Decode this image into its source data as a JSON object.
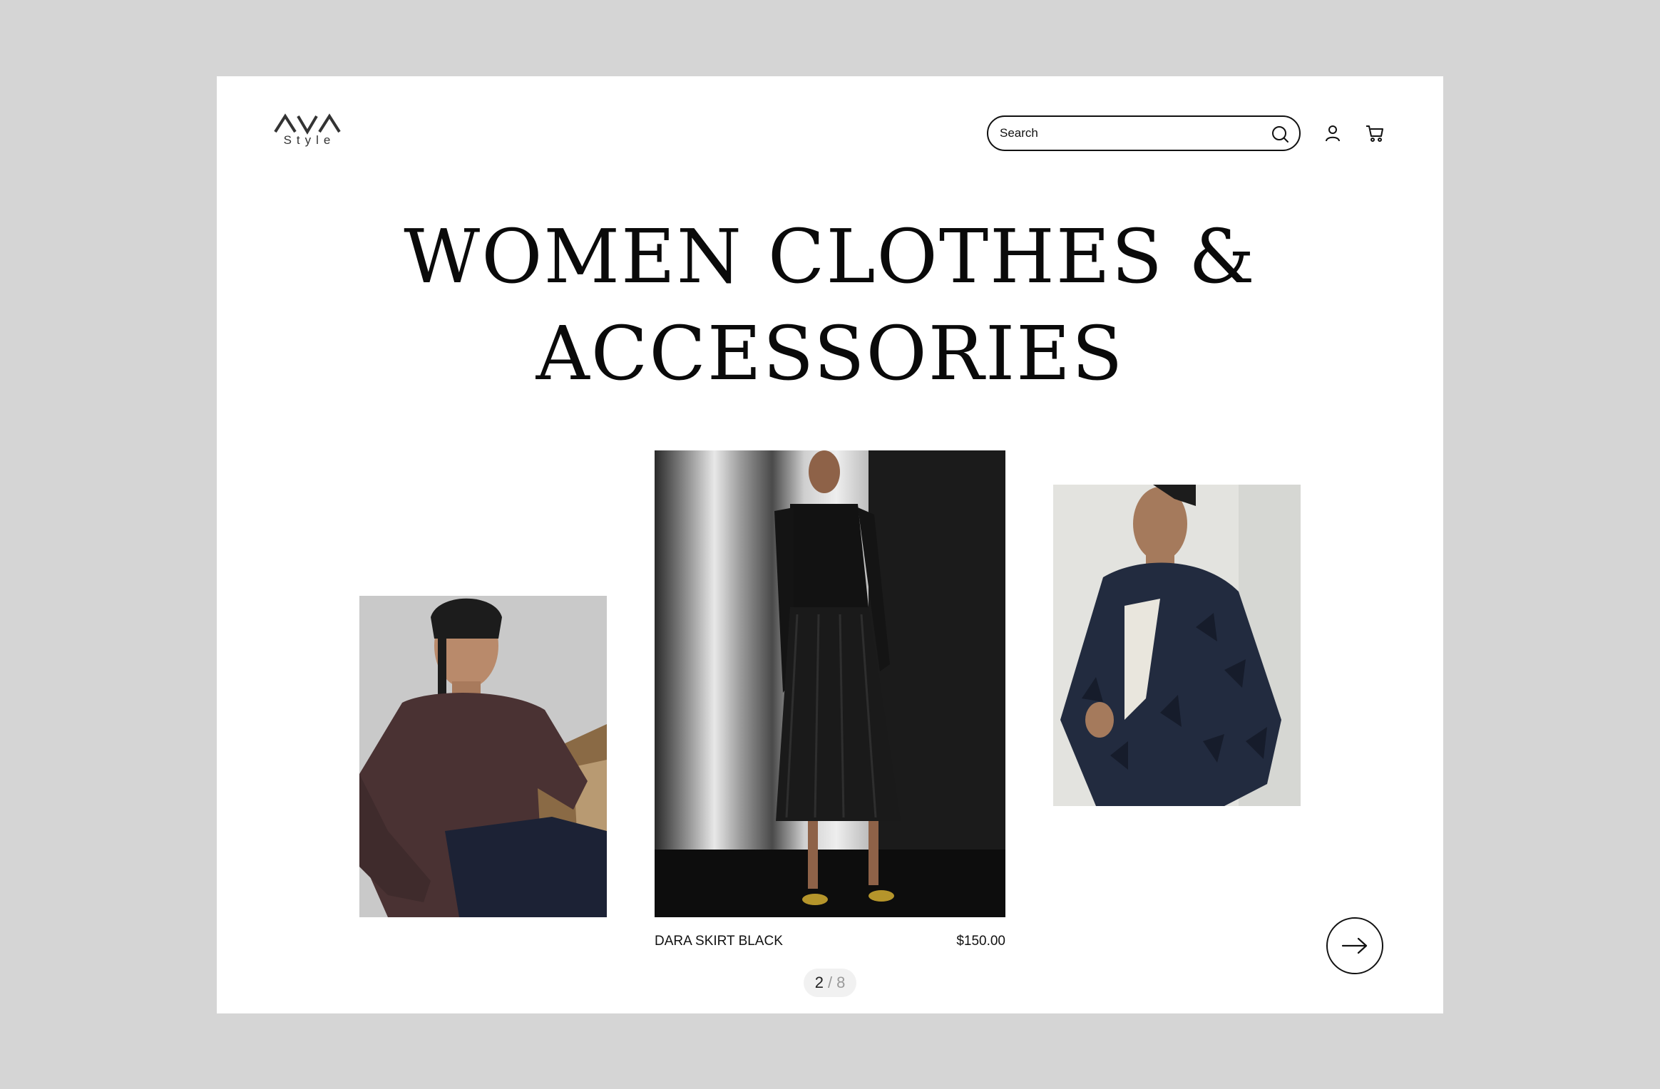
{
  "brand": {
    "logo_mark": "AVA",
    "logo_sub": "Style"
  },
  "header": {
    "search_placeholder": "Search",
    "icons": [
      "search-icon",
      "user-icon",
      "cart-icon"
    ]
  },
  "hero": {
    "title_line1": "WOMEN CLOTHES &",
    "title_line2": "ACCESSORIES"
  },
  "carousel": {
    "items": [
      {
        "image": "woman-in-knit-top-photo"
      },
      {
        "image": "woman-in-pleated-black-dress-photo"
      },
      {
        "image": "woman-in-fringe-jacket-photo"
      }
    ],
    "active_product": {
      "name": "DARA SKIRT BLACK",
      "price": "$150.00"
    },
    "pager": {
      "current": "2",
      "separator": "/",
      "total": "8"
    },
    "next_icon": "arrow-right-icon"
  }
}
